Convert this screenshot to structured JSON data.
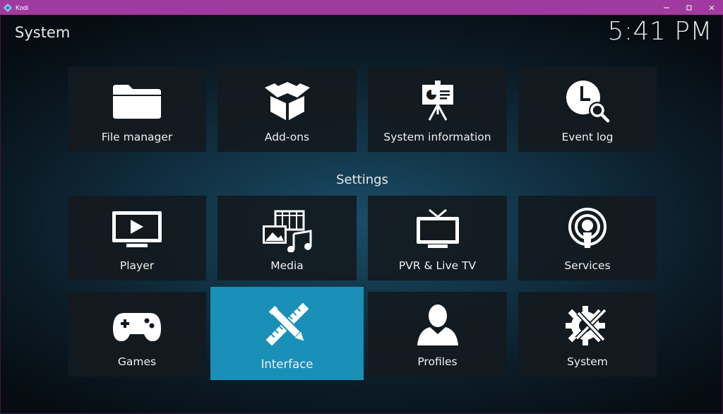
{
  "window": {
    "app_title": "Kodi"
  },
  "header": {
    "title": "System",
    "clock": "5:41 PM"
  },
  "sections": {
    "settings_heading": "Settings"
  },
  "top_tiles": [
    {
      "label": "File manager",
      "icon": "folder-icon"
    },
    {
      "label": "Add-ons",
      "icon": "box-icon"
    },
    {
      "label": "System information",
      "icon": "presentation-icon"
    },
    {
      "label": "Event log",
      "icon": "clock-search-icon"
    }
  ],
  "settings_tiles": [
    {
      "label": "Player",
      "icon": "tv-play-icon"
    },
    {
      "label": "Media",
      "icon": "media-icon"
    },
    {
      "label": "PVR & Live TV",
      "icon": "tv-antenna-icon"
    },
    {
      "label": "Services",
      "icon": "broadcast-icon"
    },
    {
      "label": "Games",
      "icon": "gamepad-icon"
    },
    {
      "label": "Interface",
      "icon": "pencil-ruler-icon",
      "focused": true
    },
    {
      "label": "Profiles",
      "icon": "user-icon"
    },
    {
      "label": "System",
      "icon": "gear-tools-icon"
    }
  ],
  "colors": {
    "titlebar": "#a13a9e",
    "focus": "#1a90b8",
    "tile": "#14191e"
  }
}
